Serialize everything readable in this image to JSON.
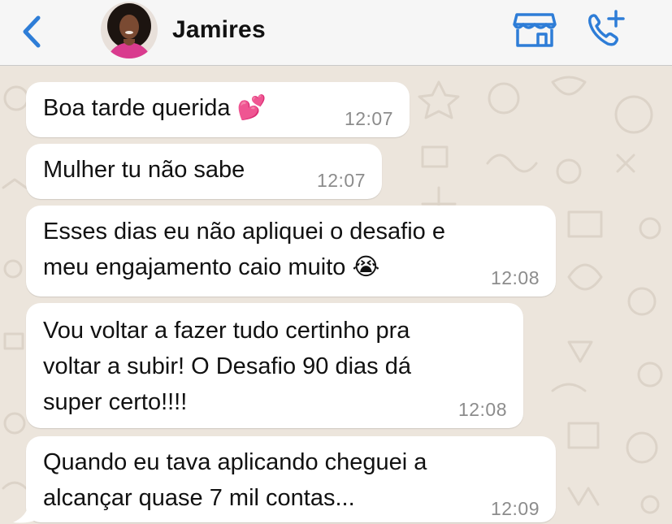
{
  "header": {
    "contact_name": "Jamires",
    "icons": {
      "back": "chevron-left-icon",
      "store": "storefront-icon",
      "call": "phone-add-icon"
    },
    "accent_color": "#2e7dd7"
  },
  "messages": [
    {
      "lines": [
        "Boa tarde querida 💕"
      ],
      "time": "12:07"
    },
    {
      "lines": [
        "Mulher tu não sabe"
      ],
      "time": "12:07"
    },
    {
      "lines": [
        "Esses dias eu não apliquei o desafio e",
        "meu engajamento caio muito 😭"
      ],
      "time": "12:08"
    },
    {
      "lines": [
        "Vou voltar a fazer tudo certinho pra",
        "voltar a subir! O Desafio 90 dias dá",
        "super certo!!!!"
      ],
      "time": "12:08"
    },
    {
      "lines": [
        "Quando eu tava aplicando cheguei a",
        "alcançar quase 7 mil contas..."
      ],
      "time": "12:09"
    }
  ],
  "colors": {
    "chat_background": "#ece5dc",
    "bubble": "#ffffff",
    "timestamp": "#8c8c8c"
  }
}
